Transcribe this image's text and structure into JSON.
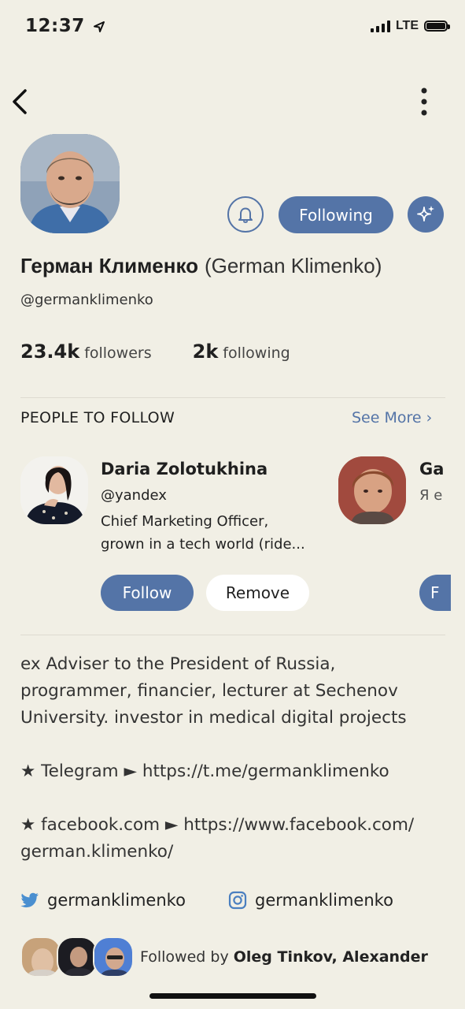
{
  "status": {
    "time": "12:37",
    "network": "LTE"
  },
  "profile": {
    "name": "Герман Клименко",
    "alt_name": "(German Klimenko)",
    "handle": "@germanklimenko",
    "followers_count": "23.4k",
    "followers_label": "followers",
    "following_count": "2k",
    "following_label": "following",
    "following_button": "Following"
  },
  "people_to_follow": {
    "title": "PEOPLE TO FOLLOW",
    "see_more": "See More ›",
    "suggestions": [
      {
        "name": "Daria Zolotukhina",
        "handle": "@yandex",
        "bio_line1": "Chief Marketing Officer,",
        "bio_line2": "grown in a tech world (ride...",
        "follow_label": "Follow",
        "remove_label": "Remove"
      },
      {
        "name": "Ga",
        "handle": "Я е",
        "follow_label": "F"
      }
    ]
  },
  "bio": {
    "line1": "ex Adviser to the President of Russia,",
    "line2": "programmer, financier, lecturer at Sechenov",
    "line3": "University. investor in medical digital projects",
    "telegram": "★ Telegram ► https://t.me/germanklimenko",
    "facebook1": "★ facebook.com ► https://www.facebook.com/",
    "facebook2": "german.klimenko/"
  },
  "social": {
    "twitter": "germanklimenko",
    "instagram": "germanklimenko"
  },
  "followed_by": {
    "prefix": "Followed by ",
    "names": "Oleg Tinkov, Alexander"
  },
  "colors": {
    "accent": "#5474a7",
    "background": "#f1efe5"
  }
}
